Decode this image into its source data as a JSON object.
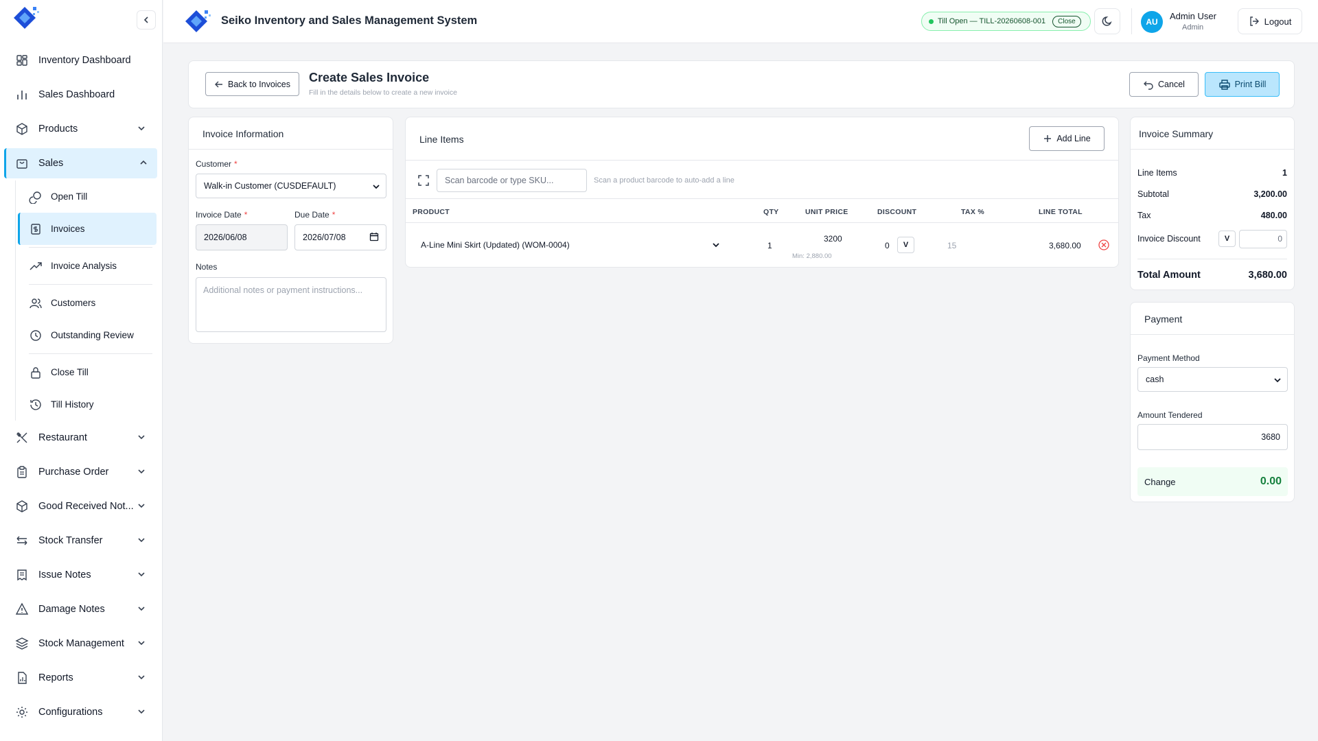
{
  "app": {
    "title": "Seiko Inventory and Sales Management System"
  },
  "header": {
    "till_status": "Till Open — TILL-20260608-001",
    "till_close_label": "Close",
    "user_initials": "AU",
    "user_name": "Admin User",
    "user_role": "Admin",
    "logout_label": "Logout"
  },
  "sidebar": {
    "items": [
      {
        "label": "Inventory Dashboard",
        "icon": "dashboard-grid-icon"
      },
      {
        "label": "Sales Dashboard",
        "icon": "bar-chart-icon"
      },
      {
        "label": "Products",
        "icon": "package-icon"
      },
      {
        "label": "Sales",
        "icon": "shopping-bag-icon"
      },
      {
        "label": "Restaurant",
        "icon": "utensils-icon"
      },
      {
        "label": "Purchase Order",
        "icon": "clipboard-icon"
      },
      {
        "label": "Good Received Not...",
        "icon": "package-check-icon"
      },
      {
        "label": "Stock Transfer",
        "icon": "arrows-transfer-icon"
      },
      {
        "label": "Issue Notes",
        "icon": "receipt-icon"
      },
      {
        "label": "Damage Notes",
        "icon": "warning-triangle-icon"
      },
      {
        "label": "Stock Management",
        "icon": "layers-icon"
      },
      {
        "label": "Reports",
        "icon": "report-chart-icon"
      },
      {
        "label": "Configurations",
        "icon": "gear-icon"
      }
    ],
    "sales_sub": [
      {
        "label": "Open Till",
        "icon": "coins-icon"
      },
      {
        "label": "Invoices",
        "icon": "invoice-dollar-icon"
      },
      {
        "label": "Invoice Analysis",
        "icon": "trending-up-icon"
      },
      {
        "label": "Customers",
        "icon": "users-icon"
      },
      {
        "label": "Outstanding Review",
        "icon": "clock-icon"
      },
      {
        "label": "Close Till",
        "icon": "lock-icon"
      },
      {
        "label": "Till History",
        "icon": "history-icon"
      }
    ]
  },
  "page": {
    "back_label": "Back to Invoices",
    "title": "Create Sales Invoice",
    "subtitle": "Fill in the details below to create a new invoice",
    "cancel_label": "Cancel",
    "print_label": "Print Bill"
  },
  "invoice_info": {
    "title": "Invoice Information",
    "customer_label": "Customer",
    "customer_value": "Walk-in Customer (CUSDEFAULT)",
    "invoice_date_label": "Invoice Date",
    "invoice_date_value": "2026/06/08",
    "due_date_label": "Due Date",
    "due_date_value": "2026/07/08",
    "notes_label": "Notes",
    "notes_placeholder": "Additional notes or payment instructions...",
    "required_mark": "*"
  },
  "line_items": {
    "title": "Line Items",
    "add_label": "Add Line",
    "scan_placeholder": "Scan barcode or type SKU...",
    "scan_hint": "Scan a product barcode to auto-add a line",
    "columns": [
      "PRODUCT",
      "QTY",
      "UNIT PRICE",
      "DISCOUNT",
      "TAX %",
      "LINE TOTAL"
    ],
    "rows": [
      {
        "product": "A-Line Mini Skirt (Updated) (WOM-0004)",
        "qty": "1",
        "unit_price": "3200",
        "min_price": "Min: 2,880.00",
        "discount": "0",
        "discount_type": "V",
        "tax": "15",
        "line_total": "3,680.00"
      }
    ]
  },
  "summary": {
    "title": "Invoice Summary",
    "line_items_label": "Line Items",
    "line_items_value": "1",
    "subtotal_label": "Subtotal",
    "subtotal_value": "3,200.00",
    "tax_label": "Tax",
    "tax_value": "480.00",
    "discount_label": "Invoice Discount",
    "discount_type": "V",
    "discount_value": "0",
    "total_label": "Total Amount",
    "total_value": "3,680.00"
  },
  "payment": {
    "title": "Payment",
    "method_label": "Payment Method",
    "method_value": "cash",
    "tendered_label": "Amount Tendered",
    "tendered_value": "3680",
    "change_label": "Change",
    "change_value": "0.00"
  }
}
